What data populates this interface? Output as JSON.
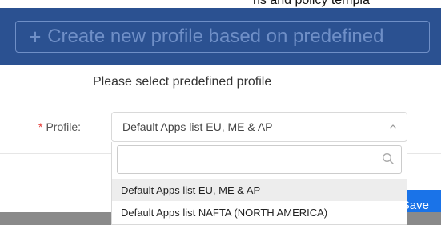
{
  "header_fragment": "ns and policy templa",
  "create_button": {
    "icon": "plus-icon",
    "label": "Create new profile based on predefined"
  },
  "select_heading": "Please select predefined profile",
  "form": {
    "required_marker": "*",
    "profile_label": "Profile:",
    "selected_value": "Default Apps list EU, ME & AP",
    "search_value": "",
    "options": [
      {
        "label": "Default Apps list EU, ME & AP",
        "highlighted": true
      },
      {
        "label": "Default Apps list NAFTA (NORTH AMERICA)",
        "highlighted": false
      }
    ]
  },
  "save_label": "Save",
  "colors": {
    "header_bg": "#2b5191",
    "button_text": "#6f8fc7",
    "save_bg": "#1a73e8",
    "required": "#e53935"
  }
}
